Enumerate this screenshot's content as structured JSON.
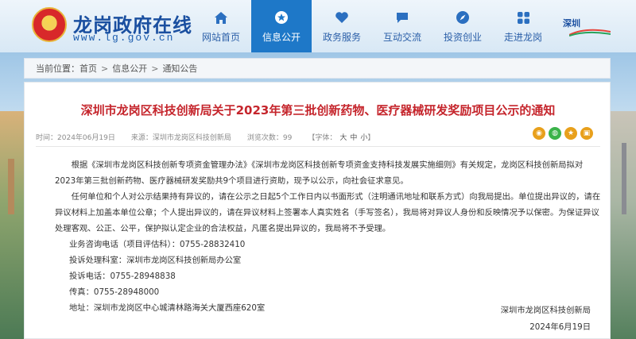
{
  "header": {
    "site_title": "龙岗政府在线",
    "site_url": "www.lg.gov.cn",
    "nav": [
      {
        "label": "网站首页",
        "icon": "home-icon"
      },
      {
        "label": "信息公开",
        "icon": "star-badge-icon",
        "active": true
      },
      {
        "label": "政务服务",
        "icon": "heart-icon"
      },
      {
        "label": "互动交流",
        "icon": "chat-icon"
      },
      {
        "label": "投资创业",
        "icon": "compass-icon"
      },
      {
        "label": "走进龙岗",
        "icon": "grid-icon"
      }
    ],
    "right_logo_text": "深圳"
  },
  "breadcrumb": {
    "prefix": "当前位置：",
    "items": [
      "首页",
      "信息公开",
      "通知公告"
    ],
    "separator": ">"
  },
  "article": {
    "title": "深圳市龙岗区科技创新局关于2023年第三批创新药物、医疗器械研发奖励项目公示的通知",
    "meta": {
      "time_label": "时间：",
      "time_value": "2024年06月19日",
      "source_label": "来源：",
      "source_value": "深圳市龙岗区科技创新局",
      "views_label": "浏览次数：",
      "views_value": "99",
      "font_label": "【字体：",
      "font_sizes": [
        "大",
        "中",
        "小"
      ],
      "font_end": "】"
    },
    "paragraphs": [
      "根据《深圳市龙岗区科技创新专项资金管理办法》《深圳市龙岗区科技创新专项资金支持科技发展实施细则》有关规定，龙岗区科技创新局拟对2023年第三批创新药物、医疗器械研发奖励共9个项目进行资助，现予以公示，向社会征求意见。",
      "任何单位和个人对公示结果持有异议的，请在公示之日起5个工作日内以书面形式（注明通讯地址和联系方式）向我局提出。单位提出异议的，请在异议材料上加盖本单位公章；个人提出异议的，请在异议材料上签署本人真实姓名（手写签名），我局将对异议人身份和反映情况予以保密。为保证异议处理客观、公正、公平，保护拟认定企业的合法权益，凡匿名提出异议的，我局将不予受理。"
    ],
    "contacts": [
      "业务咨询电话（项目评估科）：0755-28832410",
      "投诉处理科室：深圳市龙岗区科技创新局办公室",
      "投诉电话：0755-28948838",
      "传真：0755-28948000",
      "地址：深圳市龙岗区中心城清林路海关大厦西座620室"
    ],
    "signature": "深圳市龙岗区科技创新局",
    "date": "2024年6月19日"
  },
  "colors": {
    "title_red": "#c5252c",
    "nav_active": "#1e78c8",
    "brand_blue": "#1a4fa0"
  }
}
